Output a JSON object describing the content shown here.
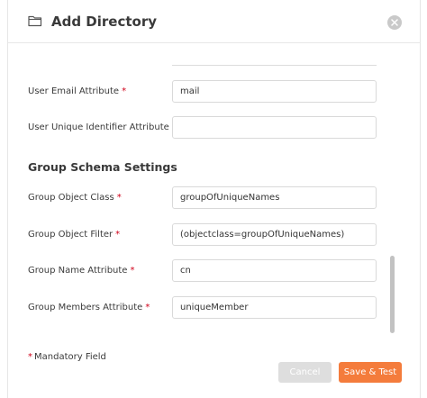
{
  "dialog": {
    "title": "Add Directory",
    "icon": "folder-icon"
  },
  "fields": {
    "user_email_attribute": {
      "label": "User Email Attribute",
      "value": "mail",
      "required": true
    },
    "user_unique_identifier_attribute": {
      "label": "User Unique Identifier Attribute",
      "value": "",
      "required": false
    }
  },
  "group_schema": {
    "title": "Group Schema Settings",
    "group_object_class": {
      "label": "Group Object Class",
      "value": "groupOfUniqueNames",
      "required": true
    },
    "group_object_filter": {
      "label": "Group Object Filter",
      "value": "(objectclass=groupOfUniqueNames)",
      "required": true
    },
    "group_name_attribute": {
      "label": "Group Name Attribute",
      "value": "cn",
      "required": true
    },
    "group_members_attribute": {
      "label": "Group Members Attribute",
      "value": "uniqueMember",
      "required": true
    }
  },
  "required_marker": "*",
  "footer": {
    "mandatory_note": "Mandatory Field",
    "cancel_label": "Cancel",
    "save_label": "Save & Test"
  },
  "colors": {
    "accent": "#f47c3c",
    "required": "#d0021b",
    "cancel_bg": "#dedede"
  }
}
